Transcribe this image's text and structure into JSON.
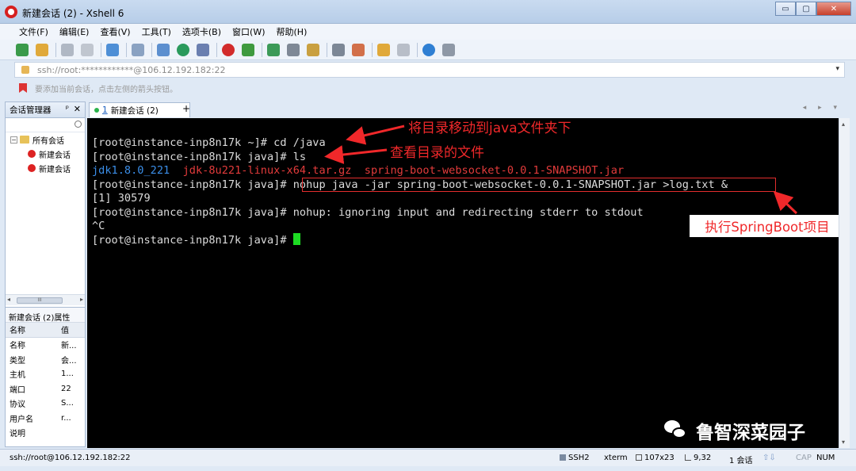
{
  "window": {
    "title": "新建会话 (2) - Xshell 6",
    "controls": [
      "▭",
      "▢",
      "✕"
    ]
  },
  "menu": [
    "文件(F)",
    "编辑(E)",
    "查看(V)",
    "工具(T)",
    "选项卡(B)",
    "窗口(W)",
    "帮助(H)"
  ],
  "address": {
    "value": "ssh://root:************@106.12.192.182:22"
  },
  "hint": "要添加当前会话，点击左侧的箭头按钮。",
  "session_manager": {
    "title": "会话管理器",
    "pin": "ᵖ",
    "close": "✕",
    "tree": {
      "root": "所有会话",
      "items": [
        "新建会话",
        "新建会话"
      ]
    },
    "scroll_label": "III"
  },
  "properties": {
    "title": "新建会话 (2)属性",
    "header": {
      "key": "名称",
      "value": "值"
    },
    "rows": [
      {
        "key": "名称",
        "value": "新..."
      },
      {
        "key": "类型",
        "value": "会..."
      },
      {
        "key": "主机",
        "value": "1..."
      },
      {
        "key": "端口",
        "value": "22"
      },
      {
        "key": "协议",
        "value": "S..."
      },
      {
        "key": "用户名",
        "value": "r..."
      },
      {
        "key": "说明",
        "value": ""
      }
    ]
  },
  "tab": {
    "number": "1",
    "label": "新建会话 (2)",
    "close": "✕",
    "add": "+",
    "nav": "◂ ▸ ▾"
  },
  "terminal": {
    "lines": [
      {
        "text": "[root@instance-inp8n17k ~]# cd /java"
      },
      {
        "text": "[root@instance-inp8n17k java]# ls"
      },
      {
        "text": ""
      },
      {
        "text": "[root@instance-inp8n17k java]# nohup java -jar spring-boot-websocket-0.0.1-SNAPSHOT.jar >log.txt &"
      },
      {
        "text": "[1] 30579"
      },
      {
        "text": "[root@instance-inp8n17k java]# nohup: ignoring input and redirecting stderr to stdout"
      },
      {
        "text": "^C"
      },
      {
        "text": "[root@instance-inp8n17k java]# "
      }
    ],
    "ls_output": {
      "dir": "jdk1.8.0_221",
      "file1": "jdk-8u221-linux-x64.tar.gz",
      "file2": "spring-boot-websocket-0.0.1-SNAPSHOT.jar"
    },
    "colors": {
      "dir": "#3b8ee8",
      "archive": "#e33b3b",
      "cursor": "#1ddb23",
      "annotation": "#f0282a"
    }
  },
  "annotations": {
    "move_dir": "将目录移动到java文件夹下",
    "view_files": "查看目录的文件",
    "run_project": "执行SpringBoot项目"
  },
  "watermark": "鲁智深菜园子",
  "status": {
    "connection": "ssh://root@106.12.192.182:22",
    "protocol": "SSH2",
    "term": "xterm",
    "size": "107x23",
    "pos": "9,32",
    "sessions": "1 会话",
    "cap": "CAP",
    "num": "NUM"
  }
}
